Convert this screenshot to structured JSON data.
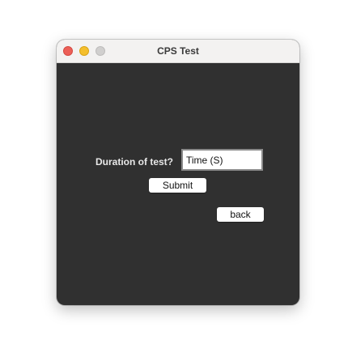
{
  "window": {
    "title": "CPS Test"
  },
  "form": {
    "duration_label": "Duration of test?",
    "time_input_value": "Time (S)",
    "submit_label": "Submit",
    "back_label": "back"
  },
  "colors": {
    "window_background": "#303030",
    "titlebar_background": "#f3f2f1",
    "close_button": "#ec5f57",
    "minimize_button": "#f4bf2d",
    "zoom_button_disabled": "#d0cfce"
  }
}
